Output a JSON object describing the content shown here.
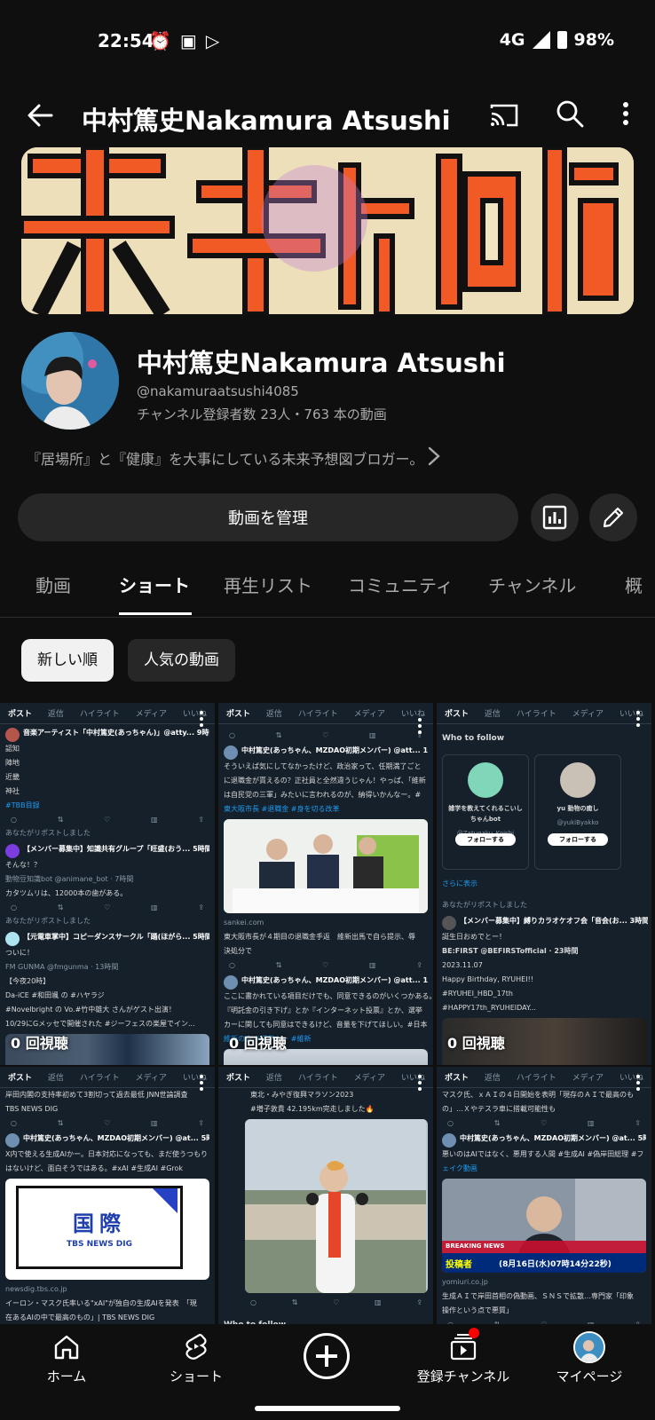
{
  "status": {
    "time": "22:54",
    "network": "4G",
    "battery": "98%"
  },
  "app_bar": {
    "title": "中村篤史Nakamura Atsushi"
  },
  "channel": {
    "name": "中村篤史Nakamura Atsushi",
    "handle": "@nakamuraatsushi4085",
    "stats": "チャンネル登録者数 23人・763 本の動画",
    "description": "『居場所』と『健康』を大事にしている未来予想図ブロガー。"
  },
  "actions": {
    "manage_label": "動画を管理"
  },
  "tabs": [
    {
      "label": "動画"
    },
    {
      "label": "ショート"
    },
    {
      "label": "再生リスト"
    },
    {
      "label": "コミュニティ"
    },
    {
      "label": "チャンネル"
    },
    {
      "label": "概"
    }
  ],
  "chips": {
    "newest": "新しい順",
    "popular": "人気の動画"
  },
  "x_tabs": [
    "ポスト",
    "返信",
    "ハイライト",
    "メディア",
    "いいね"
  ],
  "shorts": [
    {
      "views": "0 回視聴",
      "lines": [
        "音楽アーティスト「中村篤史(あっちゃん)」@atty... 9時間",
        "認知",
        "陣地",
        "近畿",
        "神社",
        "#TBB目録",
        "あなたがリポストしました",
        "【メンバー募集中】知識共有グループ「旺盛(おう... 5時間",
        "そんな！？",
        "動物豆知識bot @animane_bot · 7時間",
        "カタツムリは、12000本の歯がある。",
        "あなたがリポストしました",
        "【元電車掌中】コピーダンスサークル「踊(ほがら... 5時間",
        "ついに！",
        "FM GUNMA @fmgunma · 13時間",
        "【今夜20時】",
        "Da-iCE #和田颯 の #ハヤラジ",
        "#Novelbright の Vo.#竹中雄大 さんがゲスト出演！",
        "10/29にGメッセで開催された #ジーフェスの楽屋でイン..."
      ]
    },
    {
      "views": "0 回視聴",
      "lines": [
        "中村篤史(あっちゃん、MZDAO初期メンバー) @att... 10分",
        "そういえば気にしてなかったけど、政治家って、任期満了ごと",
        "に退職金が貰えるの？正社員と全然違うじゃん！やっぱ、「維新",
        "は自民党の三軍」みたいに言われるのが、納得いかんなー。#",
        "東大阪市長 #退職金 #身を切る改革",
        "sankei.com",
        "東大阪市長が４期目の退職金手返　維新出馬で自ら提示、辱",
        "決処分で",
        "中村篤史(あっちゃん、MZDAO初期メンバー) @att... 10分",
        "ここに書かれている項目だけでも、同意できるのがいくつかある。",
        "『明託金の引き下げ』とか『インターネット投票』とか、選挙",
        "カーに関しても同意はできるけど、音量を下げてほしい。#日本",
        "維新の会 #選挙カー #維新"
      ]
    },
    {
      "views": "0 回視聴",
      "lines": [
        "Who to follow",
        "雑学を教えてくれるこいしちゃんbot",
        "@Zatugaku_Koishi",
        "フォローする",
        "yu 動物の癒し",
        "@yukiByakko",
        "フォローする",
        "さらに表示",
        "あなたがリポストしました",
        "【メンバー募集中】縛りカラオケオフ会「音会(お... 3時間",
        "誕生日おめでとー！",
        "BE:FIRST @BEFIRSTofficial · 23時間",
        "2023.11.07",
        "Happy Birthday, RYUHEI!!",
        "#RYUHEI_HBD_17th",
        "#HAPPY17th_RYUHEIDAY..."
      ]
    },
    {
      "views": "",
      "lines": [
        "岸田内閣の支持率初めて3割切って過去最低 JNN世論調査",
        "TBS NEWS DIG",
        "中村篤史(あっちゃん、MZDAO初期メンバー) @at... 5時間",
        "X内で使える生成AIかー。日本対応になっても、まだ使うつもり",
        "はないけど、面白そうではある。#xAI #生成AI #Grok",
        "国際",
        "TBS NEWS DIG",
        "newsdig.tbs.co.jp",
        "イーロン・マスク氏率いる\"xAI\"が独自の生成AIを発表　「現",
        "在あるAIの中で最高のもの」| TBS NEWS DIG"
      ]
    },
    {
      "views": "",
      "lines": [
        "東北・みやぎ復興マラソン2023",
        "#増子敦貴 42.195km完走しました🔥",
        "Who to follow"
      ]
    },
    {
      "views": "",
      "lines": [
        "マスク氏、ｘＡＩの４日開始を表明「現存のＡＩで最高のも",
        "の」…Ｘやテスラ車に搭載可能性も",
        "中村篤史(あっちゃん、MZDAO初期メンバー) @at... 5時間",
        "悪いのはAIではなく、悪用する人間 #生成AI #偽岸田総理 #フ",
        "ェイク動画",
        "BREAKING NEWS",
        "投稿者",
        "(8月16日(水)07時14分22秒)",
        "yomiuri.co.jp",
        "生成ＡＩで岸田首相の偽動画、ＳＮＳで拡散…専門家「印象",
        "操作という点で悪質」"
      ]
    }
  ],
  "bottom_nav": {
    "home": "ホーム",
    "shorts": "ショート",
    "subscriptions": "登録チャンネル",
    "mypage": "マイページ"
  },
  "icons": {
    "back": "back-arrow-icon",
    "cast": "cast-icon",
    "search": "search-icon",
    "more": "more-vert-icon",
    "analytics": "analytics-icon",
    "edit": "pencil-icon"
  },
  "colors": {
    "background": "#0f0f0f",
    "chip_active": "#f1f1f1",
    "surface": "#272727",
    "x_bg": "#15202b",
    "x_link": "#1d9bf0"
  }
}
